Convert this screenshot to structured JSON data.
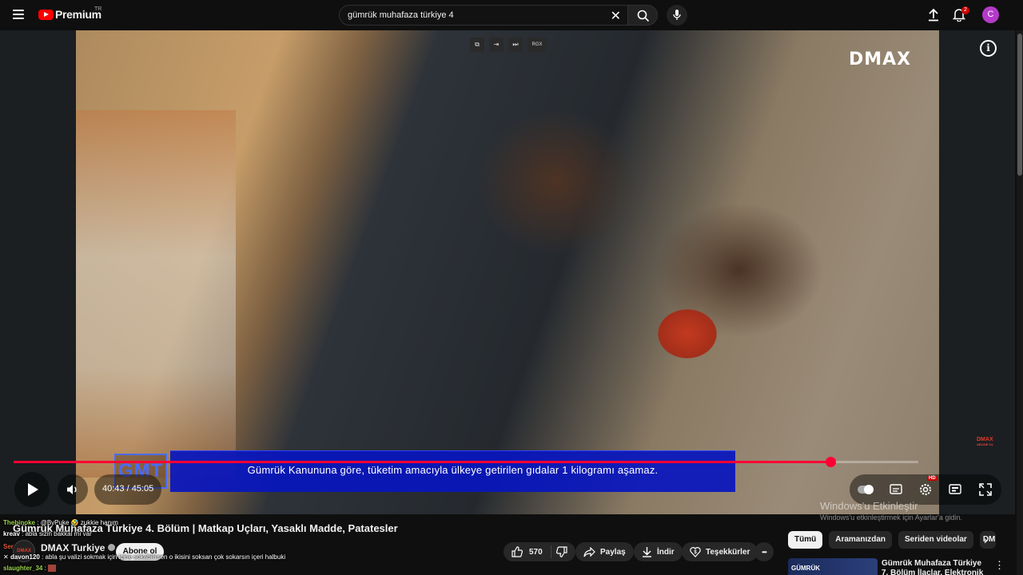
{
  "header": {
    "logo_text": "Premium",
    "logo_country": "TR",
    "search_query": "gümrük muhafaza türkiye 4",
    "notification_count": "2",
    "avatar_letter": "C"
  },
  "player": {
    "watermark_logo": "DMAX",
    "corner_logo": "DMAX",
    "corner_sub": "ABONE OL",
    "subtitle": "Gümrük Kanununa göre, tüketim amacıyla ülkeye getirilen gıdalar 1 kilogramı aşamaz.",
    "program_logo": "GMT",
    "current_time": "40:43",
    "duration": "45:05",
    "time_display": "40:43 / 45:05",
    "progress": 0.903,
    "hd_badge": "HD",
    "extension_buttons": [
      "⧉",
      "⇥",
      "⏭",
      "RGX"
    ],
    "accent_color": "#ff0033"
  },
  "windows_watermark": {
    "line1": "Windows'u Etkinleştir",
    "line2": "Windows'u etkinleştirmek için Ayarlar'a gidin."
  },
  "video": {
    "title": "Gümrük Muhafaza Türkiye 4. Bölüm | Matkap Uçları, Yasaklı Madde, Patatesler",
    "channel_name": "DMAX Turkiye",
    "channel_avatar_text": "DMAX",
    "subscribe_label": "Abone ol",
    "like_count": "570",
    "share_label": "Paylaş",
    "download_label": "İndir",
    "thanks_label": "Teşekkürler",
    "more_label": "•••"
  },
  "chips": [
    "Tümü",
    "Aramanızdan",
    "Seriden videolar",
    "DM"
  ],
  "recommendation": {
    "thumb_text": "GÜMRÜK",
    "title": "Gümrük Muhafaza Türkiye 7. Bölüm İlaçlar, Elektronik"
  },
  "chat": [
    {
      "user": "Thebinoke",
      "text": ": @ByPuke 🤣 zukkie hanım"
    },
    {
      "user": "kreav",
      "text": ": abla sizin bakkal mı var"
    },
    {
      "user": "Ser",
      "text": ""
    },
    {
      "user": "davon120",
      "text": ": abla şu valizi sokmak için içine sokabilirsen o ikisini soksan çok sokarsın içeri halbuki"
    },
    {
      "user": "slaughter_34",
      "text": ":"
    }
  ]
}
